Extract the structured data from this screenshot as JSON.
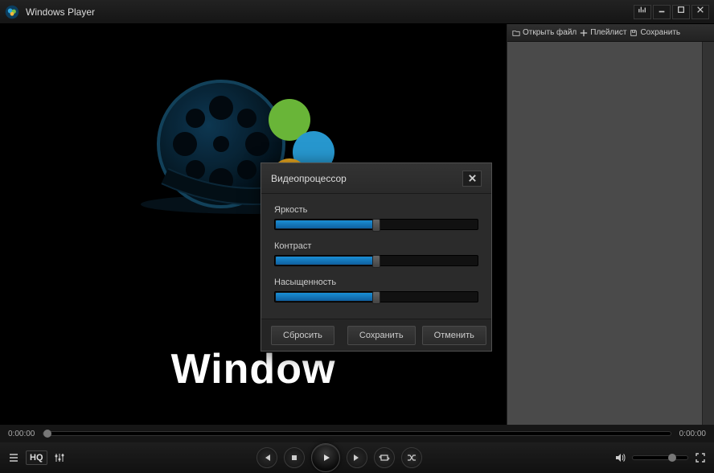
{
  "app": {
    "title": "Windows Player",
    "watermark": "Window"
  },
  "playlist_toolbar": {
    "open": "Открыть файл",
    "playlist": "Плейлист",
    "save": "Сохранить"
  },
  "dialog": {
    "title": "Видеопроцессор",
    "sliders": {
      "brightness": {
        "label": "Яркость",
        "value": 50
      },
      "contrast": {
        "label": "Контраст",
        "value": 50
      },
      "saturation": {
        "label": "Насыщенность",
        "value": 50
      }
    },
    "reset": "Сбросить",
    "save": "Сохранить",
    "cancel": "Отменить"
  },
  "seek": {
    "current": "0:00:00",
    "total": "0:00:00",
    "position": 0
  },
  "controls": {
    "hq": "HQ",
    "volume": 65
  }
}
